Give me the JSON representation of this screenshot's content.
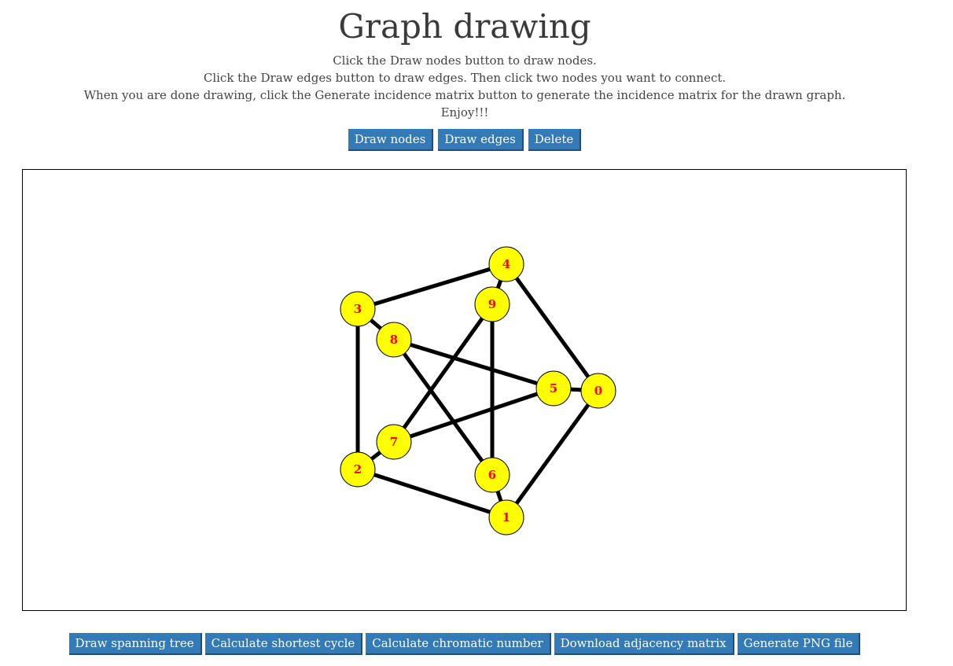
{
  "title": "Graph drawing",
  "instructions": [
    "Click the Draw nodes button to draw nodes.",
    "Click the Draw edges button to draw edges. Then click two nodes you want to connect.",
    "When you are done drawing, click the Generate incidence matrix button to generate the incidence matrix for the drawn graph.",
    "Enjoy!!!"
  ],
  "toolbar": {
    "draw_nodes": "Draw nodes",
    "draw_edges": "Draw edges",
    "delete": "Delete"
  },
  "bottom_buttons": {
    "spanning_tree": "Draw spanning tree",
    "shortest_cycle": "Calculate shortest cycle",
    "chromatic_number": "Calculate chromatic number",
    "download_adjacency": "Download adjacency matrix",
    "generate_png": "Generate PNG file"
  },
  "colors": {
    "button_bg": "#337ab7",
    "node_fill": "#ffff00",
    "node_label": "#ff0000",
    "edge": "#000000"
  },
  "graph": {
    "nodes": [
      "0",
      "1",
      "2",
      "3",
      "4",
      "5",
      "6",
      "7",
      "8",
      "9"
    ],
    "edges": [
      [
        "0",
        "1"
      ],
      [
        "1",
        "2"
      ],
      [
        "2",
        "3"
      ],
      [
        "3",
        "4"
      ],
      [
        "4",
        "0"
      ],
      [
        "0",
        "5"
      ],
      [
        "1",
        "6"
      ],
      [
        "2",
        "7"
      ],
      [
        "3",
        "8"
      ],
      [
        "4",
        "9"
      ],
      [
        "5",
        "7"
      ],
      [
        "7",
        "9"
      ],
      [
        "9",
        "6"
      ],
      [
        "6",
        "8"
      ],
      [
        "8",
        "5"
      ]
    ]
  }
}
